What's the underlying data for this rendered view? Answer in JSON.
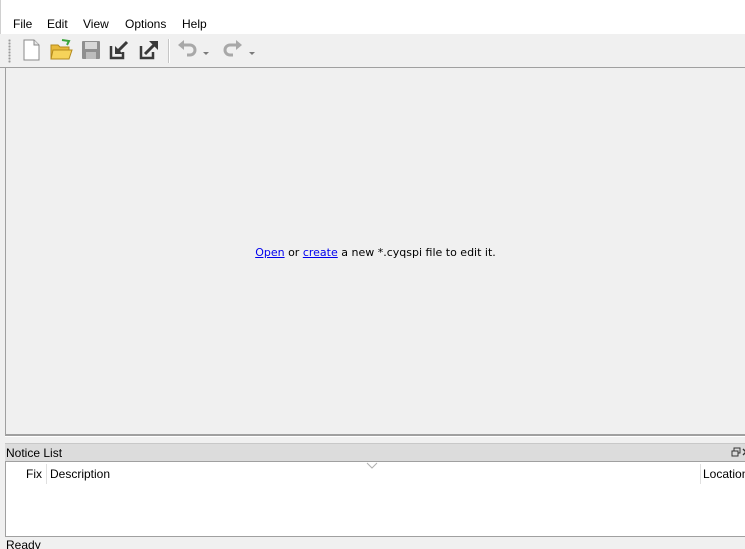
{
  "menubar": {
    "items": [
      "File",
      "Edit",
      "View",
      "Options",
      "Help"
    ]
  },
  "toolbar": {
    "buttons": [
      {
        "name": "new-file",
        "icon": "new-document-icon",
        "enabled": true
      },
      {
        "name": "open-file",
        "icon": "open-folder-icon",
        "enabled": true
      },
      {
        "name": "save-file",
        "icon": "save-disk-icon",
        "enabled": false
      },
      {
        "name": "import",
        "icon": "import-icon",
        "enabled": true
      },
      {
        "name": "export",
        "icon": "export-icon",
        "enabled": true
      },
      {
        "name": "undo",
        "icon": "undo-icon",
        "enabled": false
      },
      {
        "name": "redo",
        "icon": "redo-icon",
        "enabled": false
      }
    ]
  },
  "main": {
    "open_link": "Open",
    "or_text": " or ",
    "create_link": "create",
    "rest_text": " a new *.cyqspi file to edit it."
  },
  "notice_list": {
    "title": "Notice List",
    "columns": [
      "Fix",
      "Description",
      "Location"
    ],
    "rows": []
  },
  "status": {
    "text": "Ready"
  },
  "colors": {
    "link": "#0000ee",
    "background": "#f0f0f0",
    "dock_title": "#dcdcdc"
  }
}
